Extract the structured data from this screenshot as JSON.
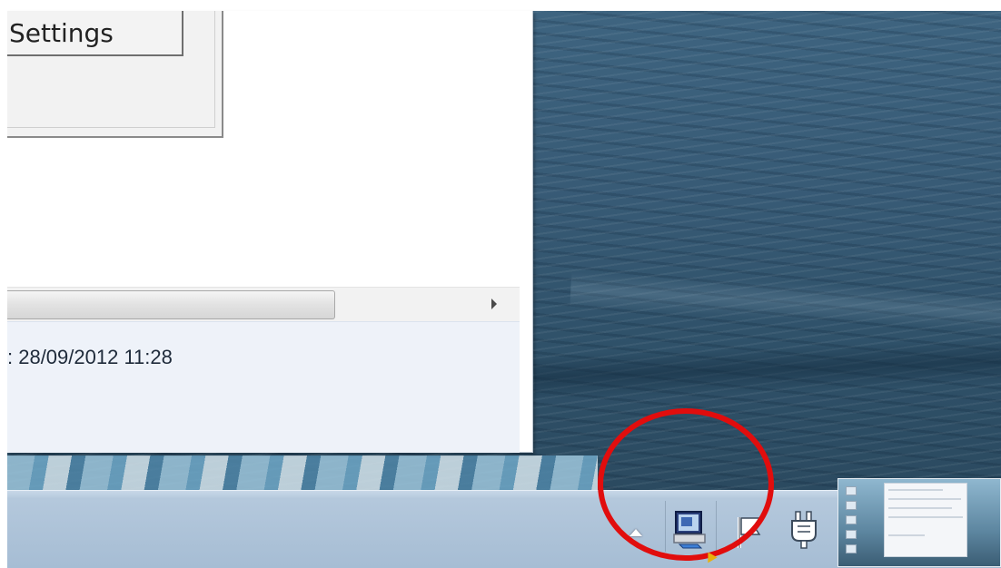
{
  "window": {
    "settings_button_label": "Settings",
    "status_text": ": 28/09/2012 11:28"
  },
  "taskbar": {
    "tray": {
      "show_hidden_icons": "chevron-up-icon",
      "icons": [
        "remote-computer-icon",
        "action-center-flag-icon",
        "power-plug-icon"
      ]
    },
    "preview_thumbnail": "desktop-preview-thumbnail"
  },
  "annotation": {
    "highlight_color": "#e10d0d",
    "shape": "ellipse"
  },
  "colors": {
    "taskbar": "#a6bdd4",
    "status_area": "#eef2f9",
    "desktop_sea": "#375a75"
  }
}
